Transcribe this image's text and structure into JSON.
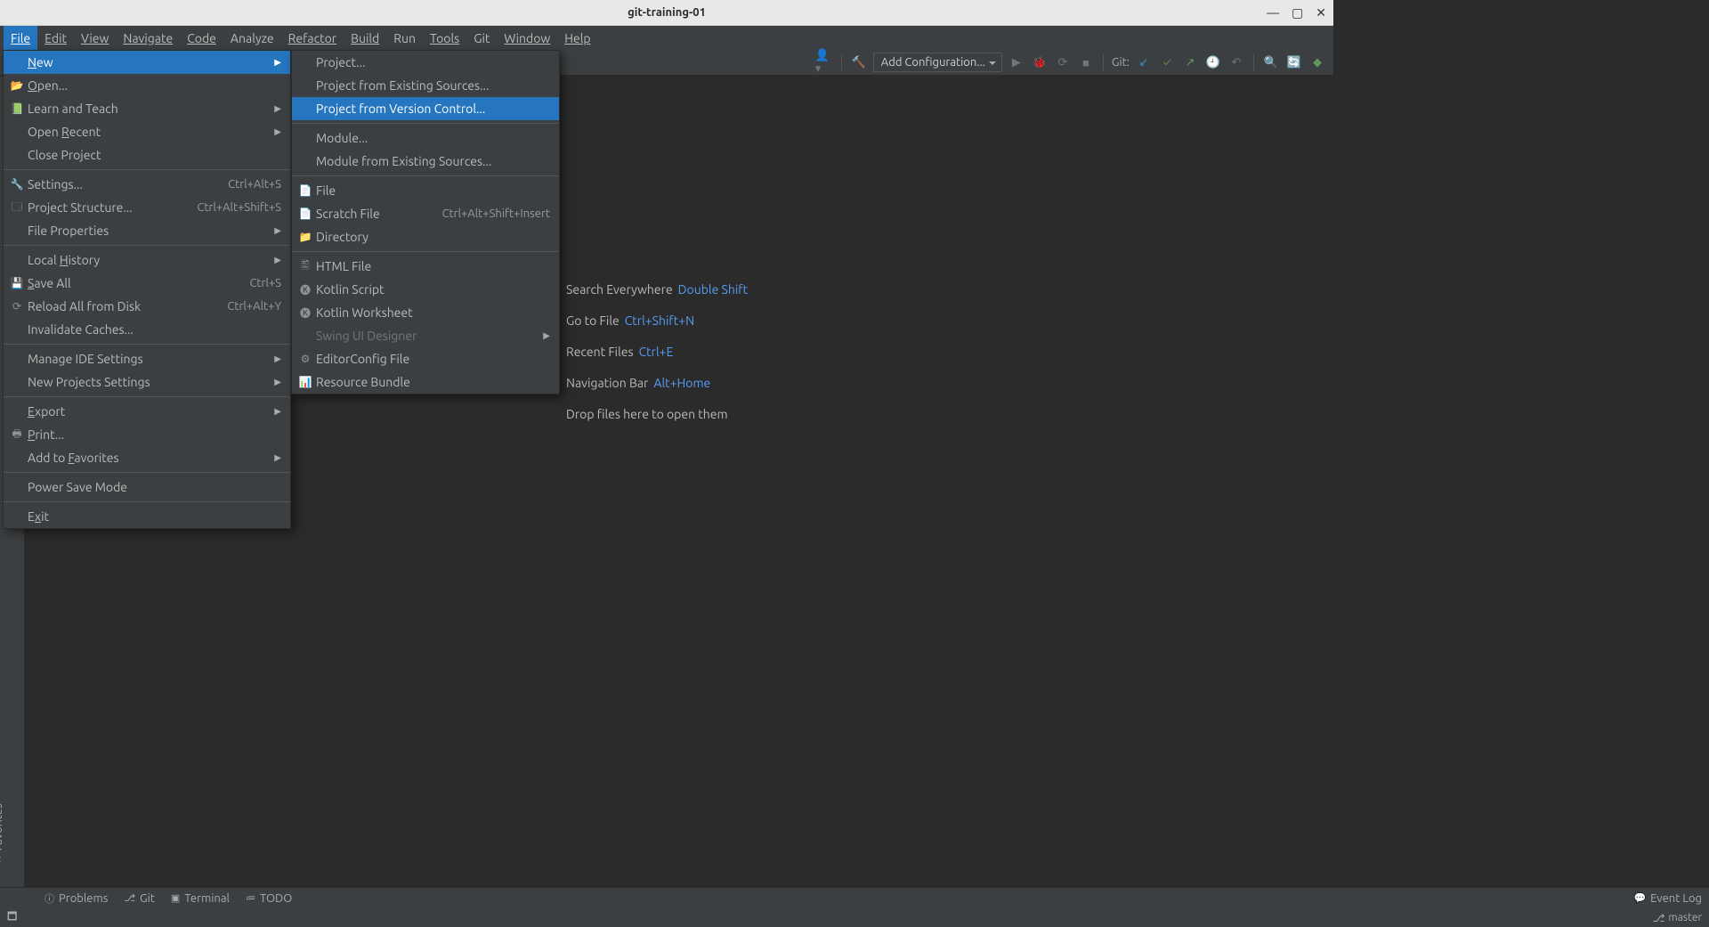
{
  "titlebar": {
    "title": "git-training-01"
  },
  "menubar": {
    "items": [
      "File",
      "Edit",
      "View",
      "Navigate",
      "Code",
      "Analyze",
      "Refactor",
      "Build",
      "Run",
      "Tools",
      "Git",
      "Window",
      "Help"
    ]
  },
  "toolbar": {
    "git_label": "Git:",
    "config": "Add Configuration..."
  },
  "file_menu": {
    "items": [
      {
        "icon": "",
        "label": "New",
        "shortcut": "",
        "arrow": true,
        "highlight": true,
        "underline": "N"
      },
      {
        "icon": "📂",
        "label": "Open...",
        "shortcut": "",
        "underline": "O"
      },
      {
        "icon": "📗",
        "label": "Learn and Teach",
        "arrow": true
      },
      {
        "icon": "",
        "label": "Open Recent",
        "arrow": true,
        "underline": "R"
      },
      {
        "icon": "",
        "label": "Close Project",
        "underline": "J"
      },
      {
        "sep": true
      },
      {
        "icon": "🔧",
        "label": "Settings...",
        "shortcut": "Ctrl+Alt+S"
      },
      {
        "icon": "🗔",
        "label": "Project Structure...",
        "shortcut": "Ctrl+Alt+Shift+S"
      },
      {
        "icon": "",
        "label": "File Properties",
        "arrow": true
      },
      {
        "sep": true
      },
      {
        "icon": "",
        "label": "Local History",
        "arrow": true,
        "underline": "H"
      },
      {
        "icon": "💾",
        "label": "Save All",
        "shortcut": "Ctrl+S",
        "underline": "S"
      },
      {
        "icon": "⟳",
        "label": "Reload All from Disk",
        "shortcut": "Ctrl+Alt+Y"
      },
      {
        "icon": "",
        "label": "Invalidate Caches..."
      },
      {
        "sep": true
      },
      {
        "icon": "",
        "label": "Manage IDE Settings",
        "arrow": true
      },
      {
        "icon": "",
        "label": "New Projects Settings",
        "arrow": true
      },
      {
        "sep": true
      },
      {
        "icon": "",
        "label": "Export",
        "arrow": true,
        "underline": "E"
      },
      {
        "icon": "🖶",
        "label": "Print...",
        "underline": "P"
      },
      {
        "icon": "",
        "label": "Add to Favorites",
        "arrow": true,
        "underline": "F"
      },
      {
        "sep": true
      },
      {
        "icon": "",
        "label": "Power Save Mode"
      },
      {
        "sep": true
      },
      {
        "icon": "",
        "label": "Exit",
        "underline": "x"
      }
    ]
  },
  "new_menu": {
    "items": [
      {
        "icon": "",
        "label": "Project..."
      },
      {
        "icon": "",
        "label": "Project from Existing Sources..."
      },
      {
        "icon": "",
        "label": "Project from Version Control...",
        "highlight": true
      },
      {
        "sep": true
      },
      {
        "icon": "",
        "label": "Module..."
      },
      {
        "icon": "",
        "label": "Module from Existing Sources..."
      },
      {
        "sep": true
      },
      {
        "icon": "📄",
        "label": "File"
      },
      {
        "icon": "📄",
        "label": "Scratch File",
        "shortcut": "Ctrl+Alt+Shift+Insert"
      },
      {
        "icon": "📁",
        "label": "Directory"
      },
      {
        "sep": true
      },
      {
        "icon": "🖺",
        "label": "HTML File"
      },
      {
        "icon": "🅚",
        "label": "Kotlin Script"
      },
      {
        "icon": "🅚",
        "label": "Kotlin Worksheet"
      },
      {
        "icon": "",
        "label": "Swing UI Designer",
        "arrow": true,
        "disabled": true
      },
      {
        "icon": "⚙",
        "label": "EditorConfig File"
      },
      {
        "icon": "📊",
        "label": "Resource Bundle"
      }
    ]
  },
  "hints": [
    {
      "label": "Search Everywhere",
      "shortcut": "Double Shift"
    },
    {
      "label": "Go to File",
      "shortcut": "Ctrl+Shift+N"
    },
    {
      "label": "Recent Files",
      "shortcut": "Ctrl+E"
    },
    {
      "label": "Navigation Bar",
      "shortcut": "Alt+Home"
    },
    {
      "label": "Drop files here to open them",
      "shortcut": ""
    }
  ],
  "left_gutter": {
    "favorites": "Favorites"
  },
  "tool_tabs": {
    "problems": "Problems",
    "git": "Git",
    "terminal": "Terminal",
    "todo": "TODO",
    "eventlog": "Event Log"
  },
  "statusbar": {
    "branch": "master"
  }
}
